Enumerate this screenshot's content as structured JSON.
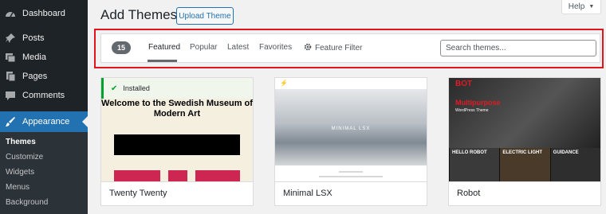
{
  "sidebar": {
    "items": [
      {
        "label": "Dashboard",
        "icon": "dashboard-icon"
      },
      {
        "label": "Posts",
        "icon": "pin-icon"
      },
      {
        "label": "Media",
        "icon": "media-icon"
      },
      {
        "label": "Pages",
        "icon": "pages-icon"
      },
      {
        "label": "Comments",
        "icon": "comment-icon"
      },
      {
        "label": "Appearance",
        "icon": "brush-icon"
      }
    ],
    "submenu": [
      "Themes",
      "Customize",
      "Widgets",
      "Menus",
      "Background"
    ]
  },
  "header": {
    "title": "Add Themes",
    "upload_label": "Upload Theme",
    "help_label": "Help"
  },
  "filter": {
    "count": "15",
    "tabs": [
      "Featured",
      "Popular",
      "Latest",
      "Favorites"
    ],
    "feature_filter": "Feature Filter",
    "search_placeholder": "Search themes..."
  },
  "themes": [
    {
      "name": "Twenty Twenty",
      "installed_label": "Installed",
      "preview_title": "Welcome to the Swedish Museum of Modern Art"
    },
    {
      "name": "Minimal LSX",
      "preview_title": "MINIMAL LSX"
    },
    {
      "name": "Robot",
      "preview_logo": "BOT",
      "preview_heading": "Multipurpose",
      "preview_sub": "WordPress Theme",
      "tiles": [
        "HELLO ROBOT",
        "ELECTRIC LIGHT",
        "GUIDANCE"
      ]
    }
  ],
  "colors": {
    "accent": "#2271b1",
    "sidebar": "#1d2327",
    "highlight": "#e0161c",
    "installed": "#00a32a"
  }
}
